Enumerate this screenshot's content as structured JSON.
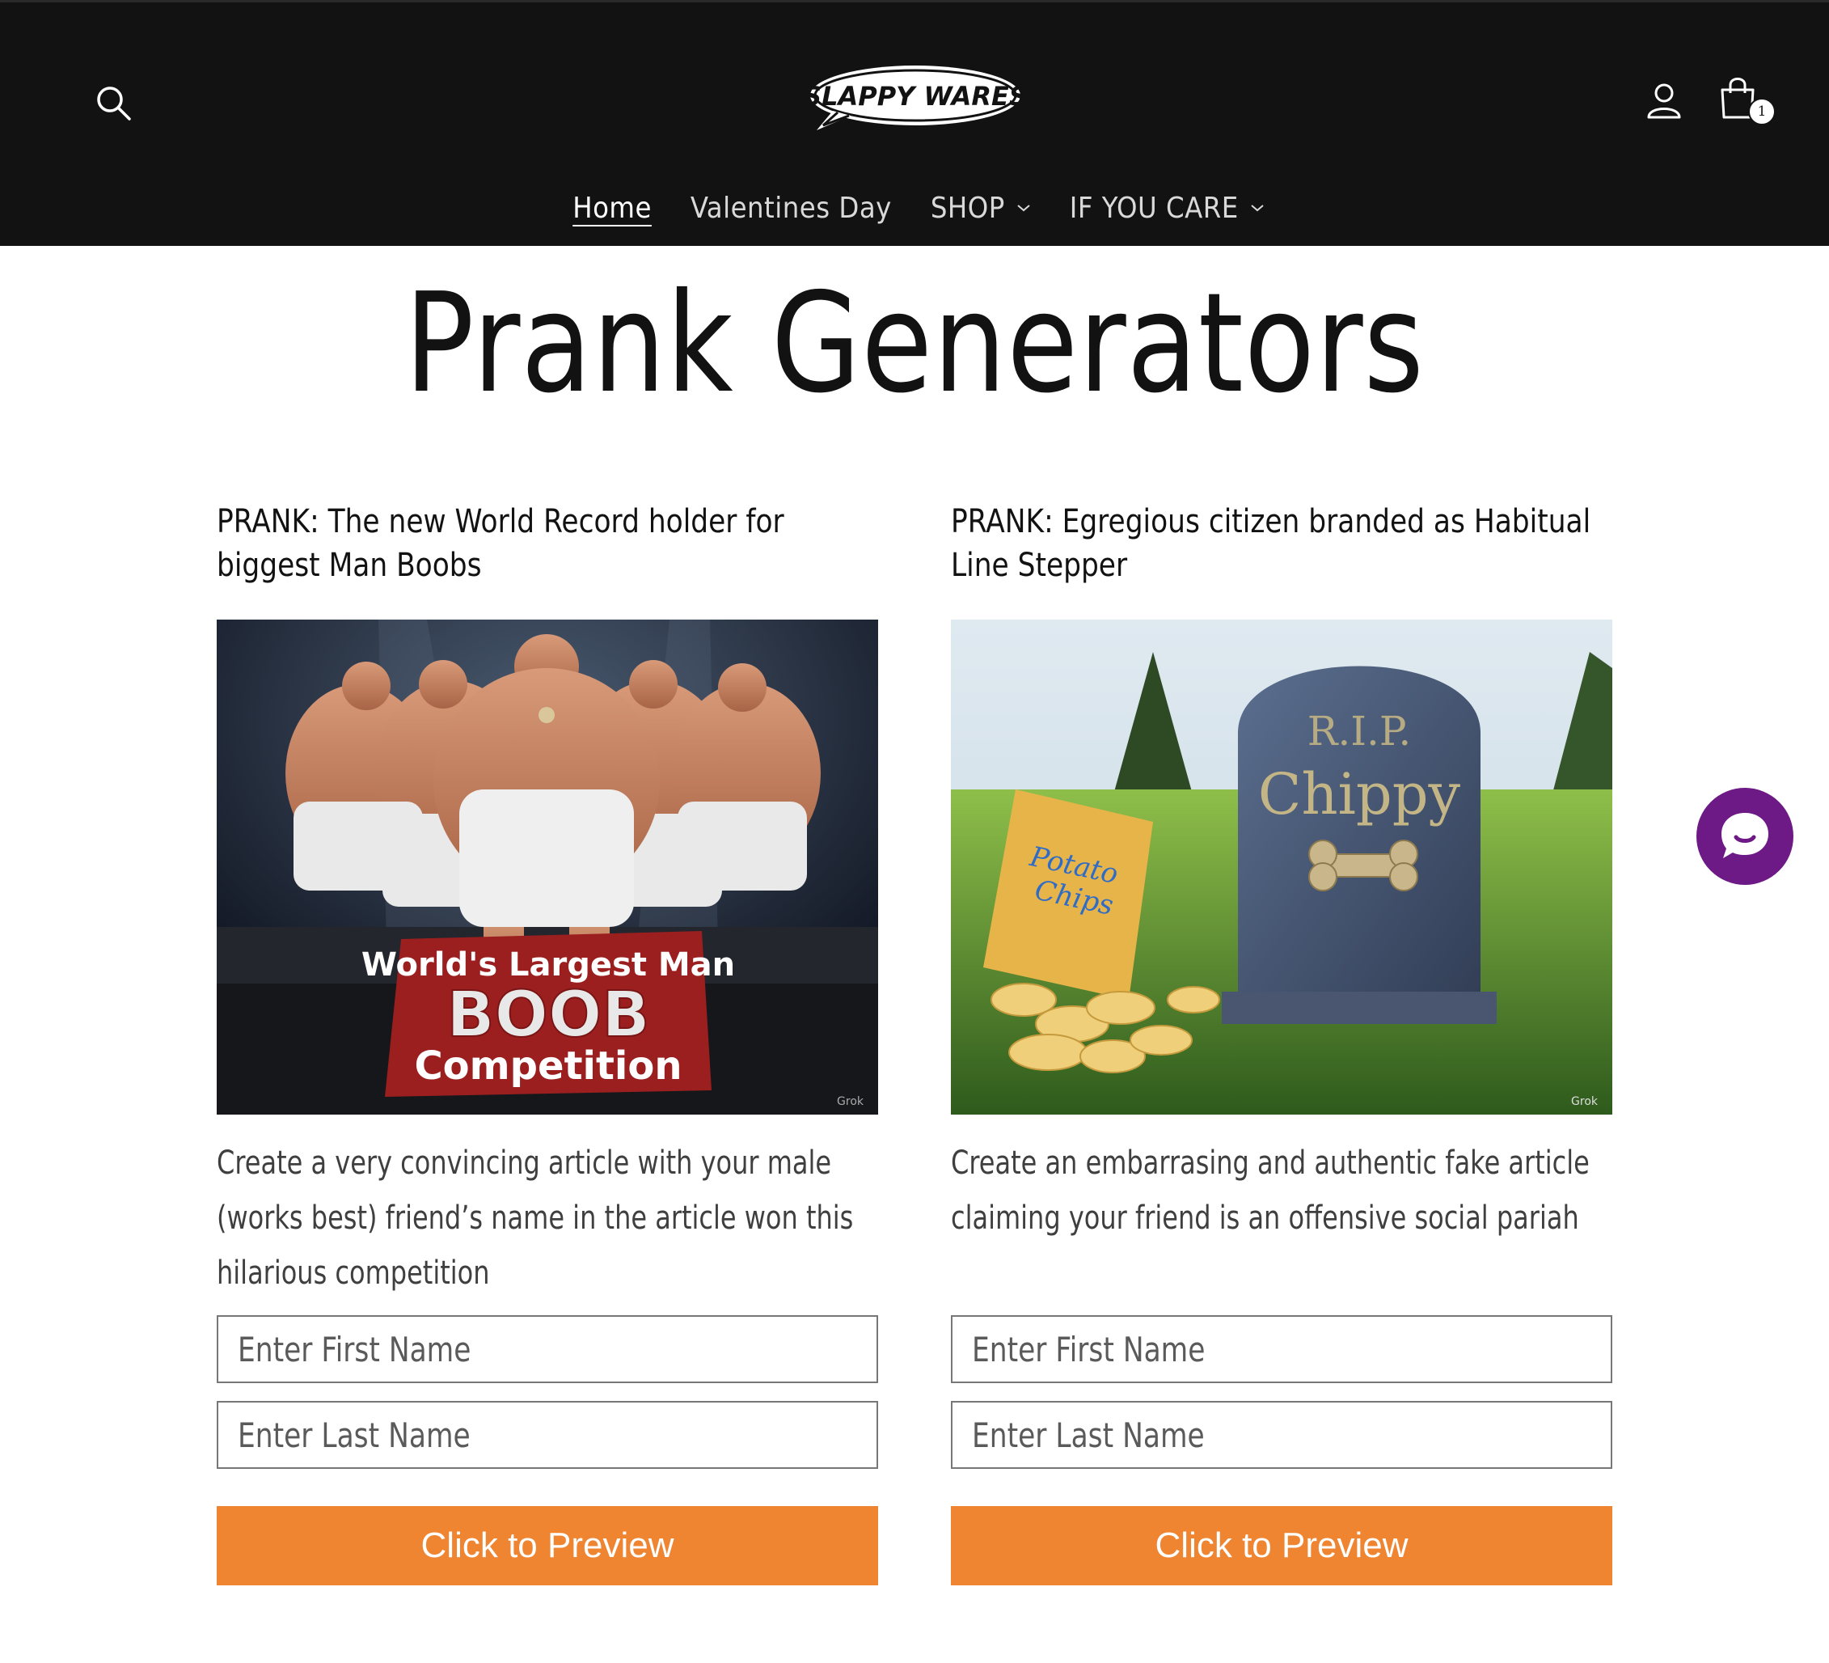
{
  "header": {
    "logo_text": "SLAPPY WARES",
    "cart_count": "1",
    "colors": {
      "background": "#121212",
      "text": "#ffffff"
    }
  },
  "nav": {
    "items": [
      {
        "label": "Home",
        "active": true,
        "has_dropdown": false
      },
      {
        "label": "Valentines Day",
        "active": false,
        "has_dropdown": false
      },
      {
        "label": "SHOP",
        "active": false,
        "has_dropdown": true
      },
      {
        "label": "IF YOU CARE",
        "active": false,
        "has_dropdown": true
      }
    ]
  },
  "page": {
    "title": "Prank Generators"
  },
  "cards": [
    {
      "title": "PRANK: The new World Record holder for biggest Man Boobs",
      "image_text": {
        "line1": "World's Largest Man",
        "line2": "BOOB",
        "line3": "Competition",
        "watermark": "Grok"
      },
      "description": "Create a very convincing article with your male (works best) friend’s name in the article won this hilarious competition",
      "first_name_placeholder": "Enter First Name",
      "last_name_placeholder": "Enter Last Name",
      "button_label": "Click to Preview"
    },
    {
      "title": "PRANK: Egregious citizen branded as Habitual Line Stepper",
      "image_text": {
        "stone_line1": "R.I.P.",
        "stone_line2": "Chippy",
        "bag_line1": "Potato",
        "bag_line2": "Chips",
        "watermark": "Grok"
      },
      "description": "Create an embarrasing and authentic fake article claiming your friend is an offensive social pariah",
      "first_name_placeholder": "Enter First Name",
      "last_name_placeholder": "Enter Last Name",
      "button_label": "Click to Preview"
    }
  ],
  "theme": {
    "accent_button": "#ef8431",
    "chat_bubble": "#6e1a86"
  }
}
